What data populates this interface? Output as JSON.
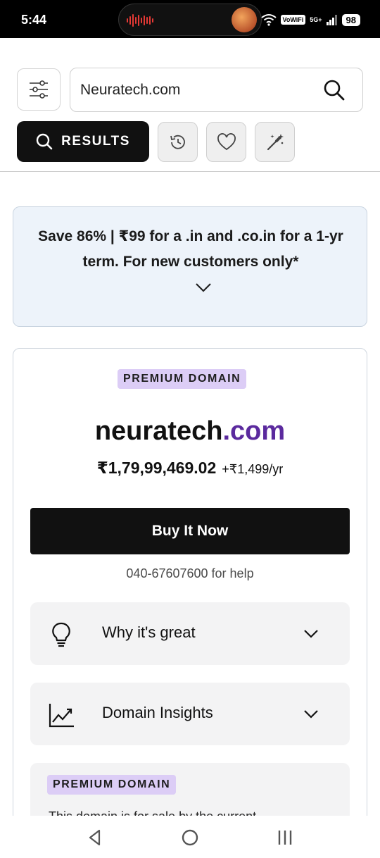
{
  "status_bar": {
    "time": "5:44",
    "vowifi": "VoWiFi",
    "network": "5G+",
    "battery": "98"
  },
  "search": {
    "value": "Neuratech.com",
    "placeholder": ""
  },
  "tabs": {
    "results_label": "RESULTS"
  },
  "promo": {
    "text": "Save 86% | ₹99 for a .in and .co.in for a 1-yr term. For new customers only*"
  },
  "domain": {
    "badge": "PREMIUM DOMAIN",
    "name_sld": "neuratech",
    "name_tld": ".com",
    "price": "₹1,79,99,469.02",
    "renewal": "+₹1,499/yr",
    "buy_label": "Buy It Now",
    "help_text": "040-67607600 for help"
  },
  "accordions": [
    {
      "label": "Why it's great",
      "icon": "lightbulb-icon"
    },
    {
      "label": "Domain Insights",
      "icon": "chart-trend-icon"
    }
  ],
  "info": {
    "badge": "PREMIUM DOMAIN",
    "text": "This domain is for sale by the current"
  },
  "colors": {
    "primary_dark": "#111111",
    "tld_purple": "#5b2a9e",
    "badge_bg": "#dccdf6",
    "promo_bg": "#edf3fa"
  }
}
